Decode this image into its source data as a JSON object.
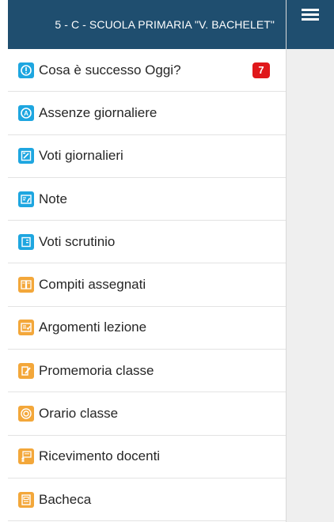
{
  "header": {
    "title": "5 - C - SCUOLA PRIMARIA \"V. BACHELET\""
  },
  "menu": {
    "items": [
      {
        "label": "Cosa è successo Oggi?",
        "icon": "info-icon",
        "color": "#1ea6e0",
        "badge": "7"
      },
      {
        "label": "Assenze giornaliere",
        "icon": "absence-icon",
        "color": "#1ea6e0"
      },
      {
        "label": "Voti giornalieri",
        "icon": "grades-icon",
        "color": "#1ea6e0"
      },
      {
        "label": "Note",
        "icon": "notes-icon",
        "color": "#1ea6e0"
      },
      {
        "label": "Voti scrutinio",
        "icon": "report-card-icon",
        "color": "#1ea6e0"
      },
      {
        "label": "Compiti assegnati",
        "icon": "homework-icon",
        "color": "#f3a73a"
      },
      {
        "label": "Argomenti lezione",
        "icon": "lesson-topics-icon",
        "color": "#f3a73a"
      },
      {
        "label": "Promemoria classe",
        "icon": "reminder-icon",
        "color": "#f3a73a"
      },
      {
        "label": "Orario classe",
        "icon": "timetable-icon",
        "color": "#f3a73a"
      },
      {
        "label": "Ricevimento docenti",
        "icon": "teacher-meeting-icon",
        "color": "#f3a73a"
      },
      {
        "label": "Bacheca",
        "icon": "bulletin-board-icon",
        "color": "#f3a73a"
      }
    ]
  },
  "colors": {
    "header_bg": "#1f4e6f",
    "badge_bg": "#e0181b"
  }
}
